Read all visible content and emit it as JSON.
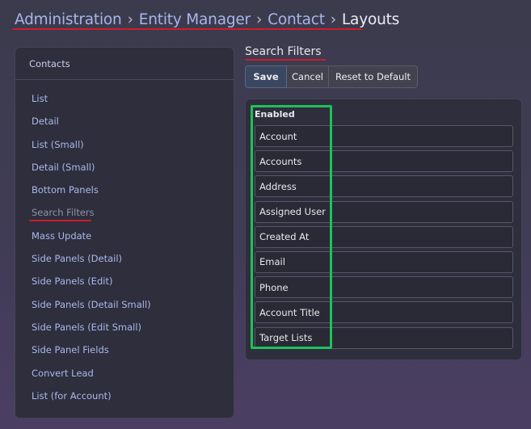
{
  "breadcrumb": {
    "items": [
      "Administration",
      "Entity Manager",
      "Contact"
    ],
    "current": "Layouts",
    "separator": "›"
  },
  "sidebar": {
    "header": "Contacts",
    "active_item": "Search Filters",
    "items": [
      "List",
      "Detail",
      "List (Small)",
      "Detail (Small)",
      "Bottom Panels",
      "Search Filters",
      "Mass Update",
      "Side Panels (Detail)",
      "Side Panels (Edit)",
      "Side Panels (Detail Small)",
      "Side Panels (Edit Small)",
      "Side Panel Fields",
      "Convert Lead",
      "List (for Account)"
    ]
  },
  "main": {
    "title": "Search Filters",
    "buttons": {
      "save": "Save",
      "cancel": "Cancel",
      "reset": "Reset to Default"
    },
    "enabled_label": "Enabled",
    "enabled_fields": [
      "Account",
      "Accounts",
      "Address",
      "Assigned User",
      "Created At",
      "Email",
      "Phone",
      "Account Title",
      "Target Lists"
    ]
  },
  "colors": {
    "underline_annotation": "#cc1d2c",
    "box_annotation": "#1ec15a",
    "link": "#aab8ec"
  }
}
